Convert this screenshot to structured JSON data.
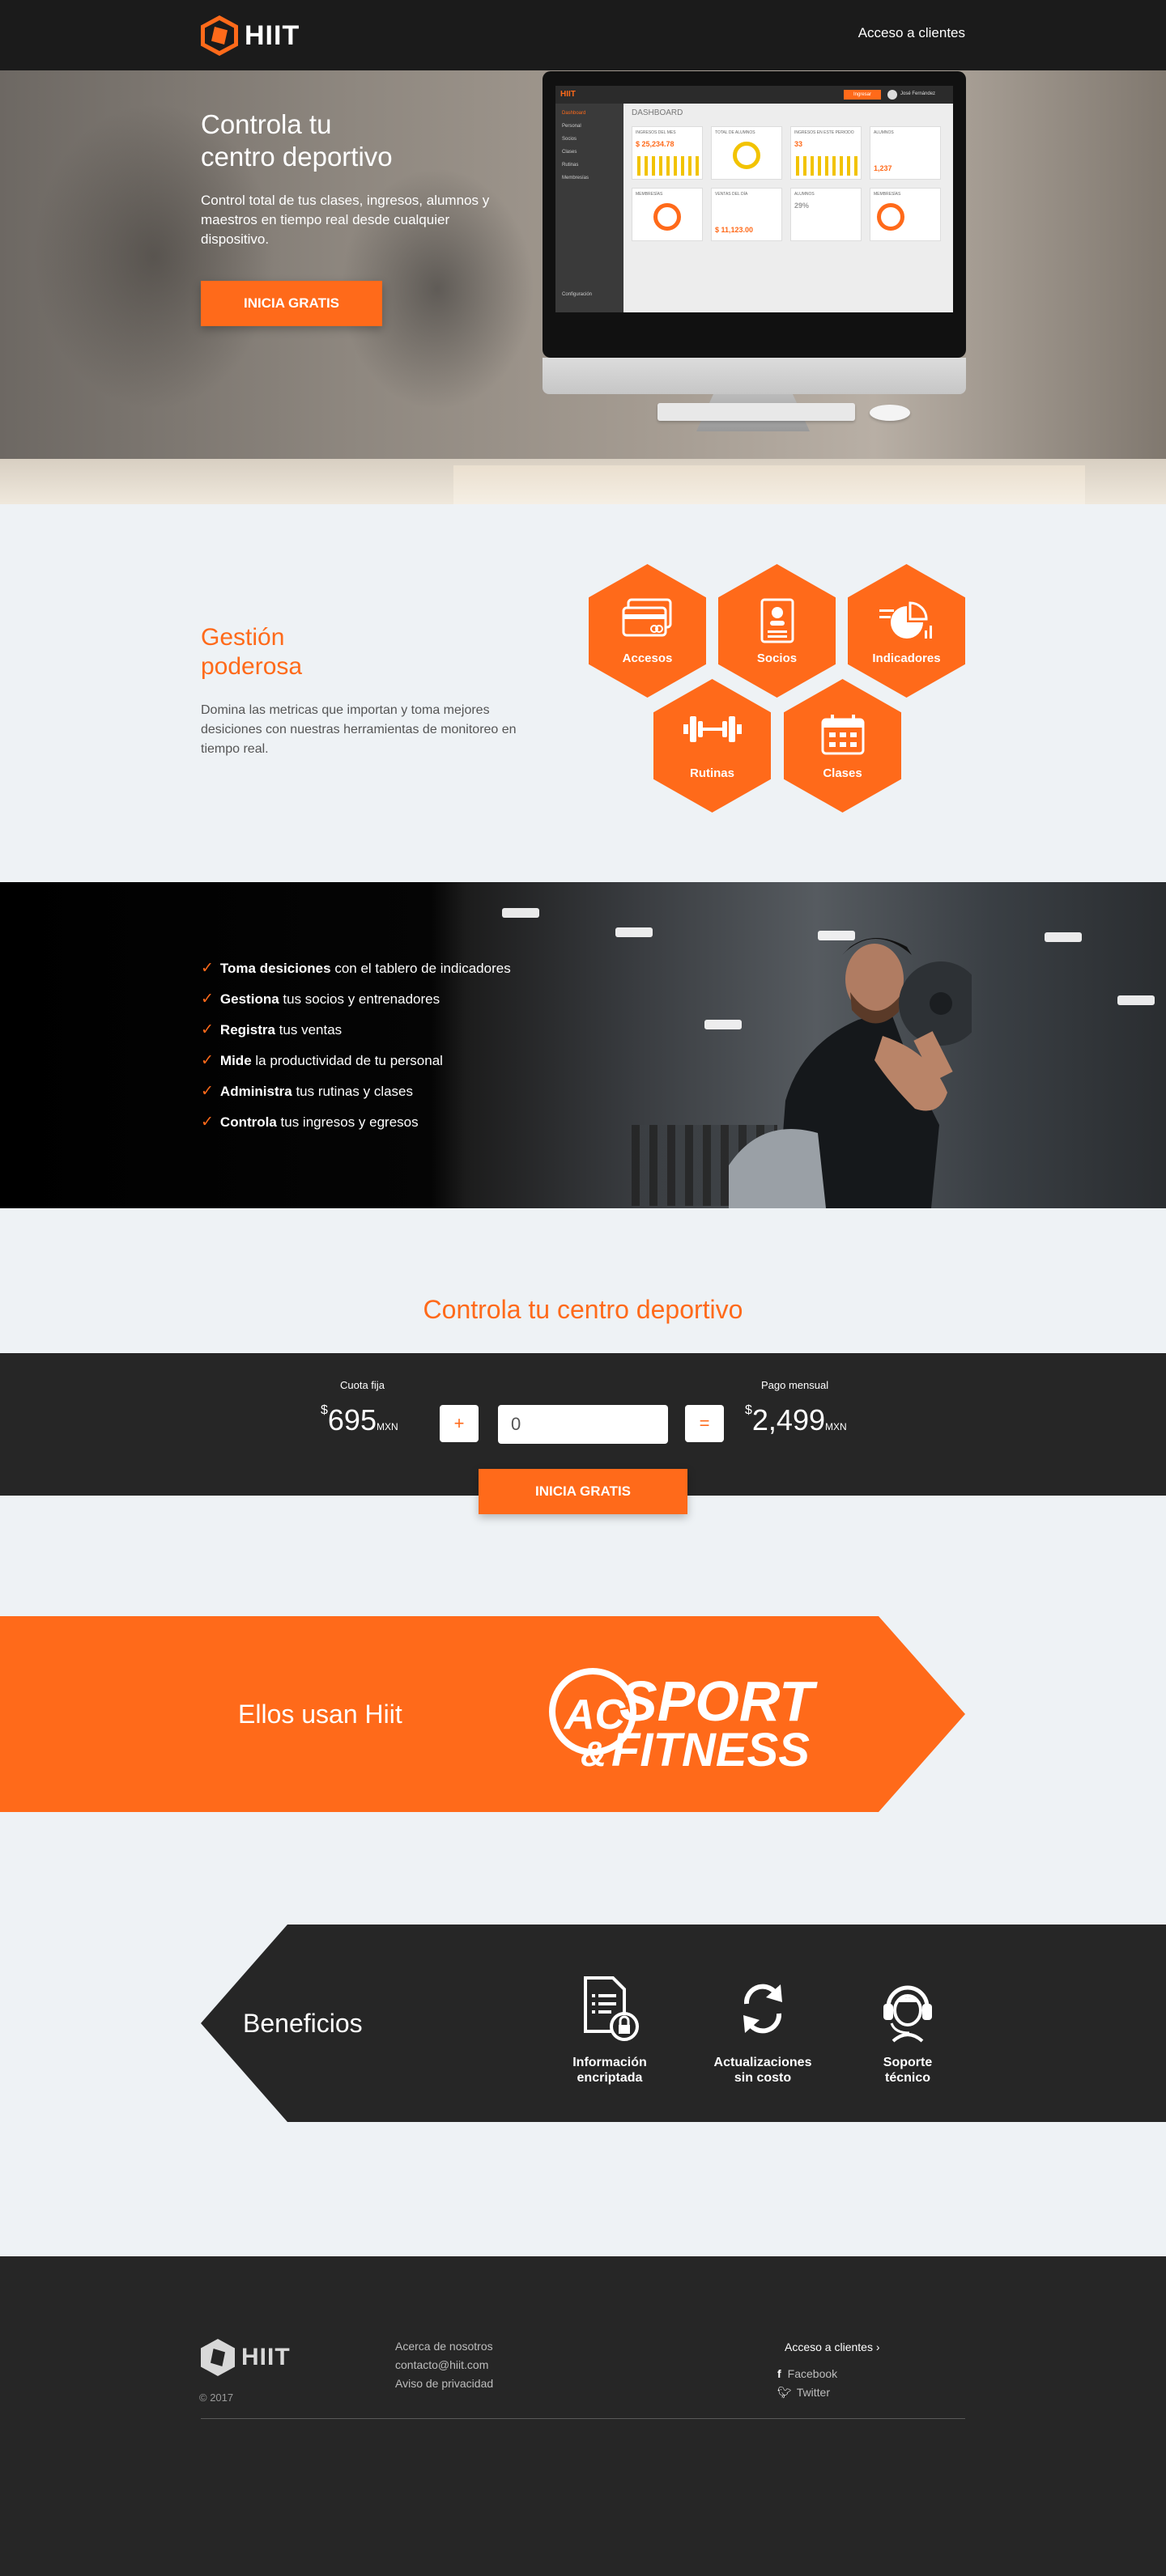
{
  "nav": {
    "logo_text": "HIIT",
    "client_link": "Acceso a clientes"
  },
  "hero": {
    "title_line1": "Controla tu",
    "title_line2": "centro deportivo",
    "subtitle": "Control total de tus clases, ingresos, alumnos y maestros en tiempo real desde cualquier dispositivo.",
    "cta": "INICIA GRATIS",
    "dashboard": {
      "logo": "HIIT",
      "title": "DASHBOARD",
      "user": "José Fernández",
      "top_button": "Ingresar",
      "menu": [
        "Dashboard",
        "Personal",
        "Socios",
        "Clases",
        "Rutinas",
        "Membresías"
      ],
      "settings": "Configuración",
      "cards": [
        {
          "title": "INGRESOS DEL MES",
          "value": "$ 25,234.78"
        },
        {
          "title": "TOTAL DE ALUMNOS",
          "value": ""
        },
        {
          "title": "INGRESOS EN ESTE PERIODO",
          "value": "33"
        },
        {
          "title": "ALUMNOS",
          "value": "1,237"
        },
        {
          "title": "MEMBRESÍAS",
          "value": "63%"
        },
        {
          "title": "VENTAS DEL DÍA",
          "value": "$ 11,123.00"
        },
        {
          "title": "ALUMNOS",
          "value": "29%"
        },
        {
          "title": "MEMBRESÍAS",
          "value": "76%"
        }
      ]
    }
  },
  "features": {
    "title_line1": "Gestión",
    "title_line2": "poderosa",
    "subtitle": "Domina las metricas que importan y toma mejores desiciones con nuestras herramientas de monitoreo en tiempo real.",
    "items": [
      {
        "label": "Accesos",
        "icon": "credit-cards-icon"
      },
      {
        "label": "Socios",
        "icon": "member-card-icon"
      },
      {
        "label": "Indicadores",
        "icon": "pie-chart-icon"
      },
      {
        "label": "Rutinas",
        "icon": "dumbbell-icon"
      },
      {
        "label": "Clases",
        "icon": "calendar-icon"
      }
    ]
  },
  "checklist": [
    {
      "bold": "Toma desiciones",
      "rest": " con el tablero de indicadores"
    },
    {
      "bold": "Gestiona",
      "rest": " tus socios y entrenadores"
    },
    {
      "bold": "Registra",
      "rest": " tus ventas"
    },
    {
      "bold": "Mide",
      "rest": " la productividad de tu personal"
    },
    {
      "bold": "Administra",
      "rest": " tus rutinas y clases"
    },
    {
      "bold": "Controla",
      "rest": " tus ingresos y egresos"
    }
  ],
  "pricing": {
    "title": "Controla tu centro deportivo",
    "fixed_label": "Cuota fija",
    "fixed_currency": "$",
    "fixed_value": "695",
    "fixed_unit": "MXN",
    "plus": "+",
    "input_value": "0",
    "equals": "=",
    "monthly_label": "Pago mensual",
    "monthly_currency": "$",
    "monthly_value": "2,499",
    "monthly_unit": "MXN",
    "cta": "INICIA GRATIS"
  },
  "clients": {
    "label": "Ellos usan Hiit",
    "logo_badge": "AC",
    "logo_line1": "SPORT",
    "logo_amp": "&",
    "logo_line2": "FITNESS"
  },
  "benefits": {
    "title": "Beneficios",
    "items": [
      {
        "line1": "Información",
        "line2": "encriptada",
        "icon": "encrypted-document-icon"
      },
      {
        "line1": "Actualizaciones",
        "line2": "sin costo",
        "icon": "refresh-icon"
      },
      {
        "line1": "Soporte",
        "line2": "técnico",
        "icon": "support-headset-icon"
      }
    ]
  },
  "footer": {
    "logo_text": "HIIT",
    "copyright": "© 2017",
    "links": [
      "Acerca de nosotros",
      "contacto@hiit.com",
      "Aviso de privacidad"
    ],
    "client_link": "Acceso a clientes",
    "social": [
      "Facebook",
      "Twitter"
    ]
  },
  "colors": {
    "accent": "#ff6a1a",
    "dark": "#262626",
    "nav": "#1b1b1b",
    "background": "#eef2f5"
  }
}
